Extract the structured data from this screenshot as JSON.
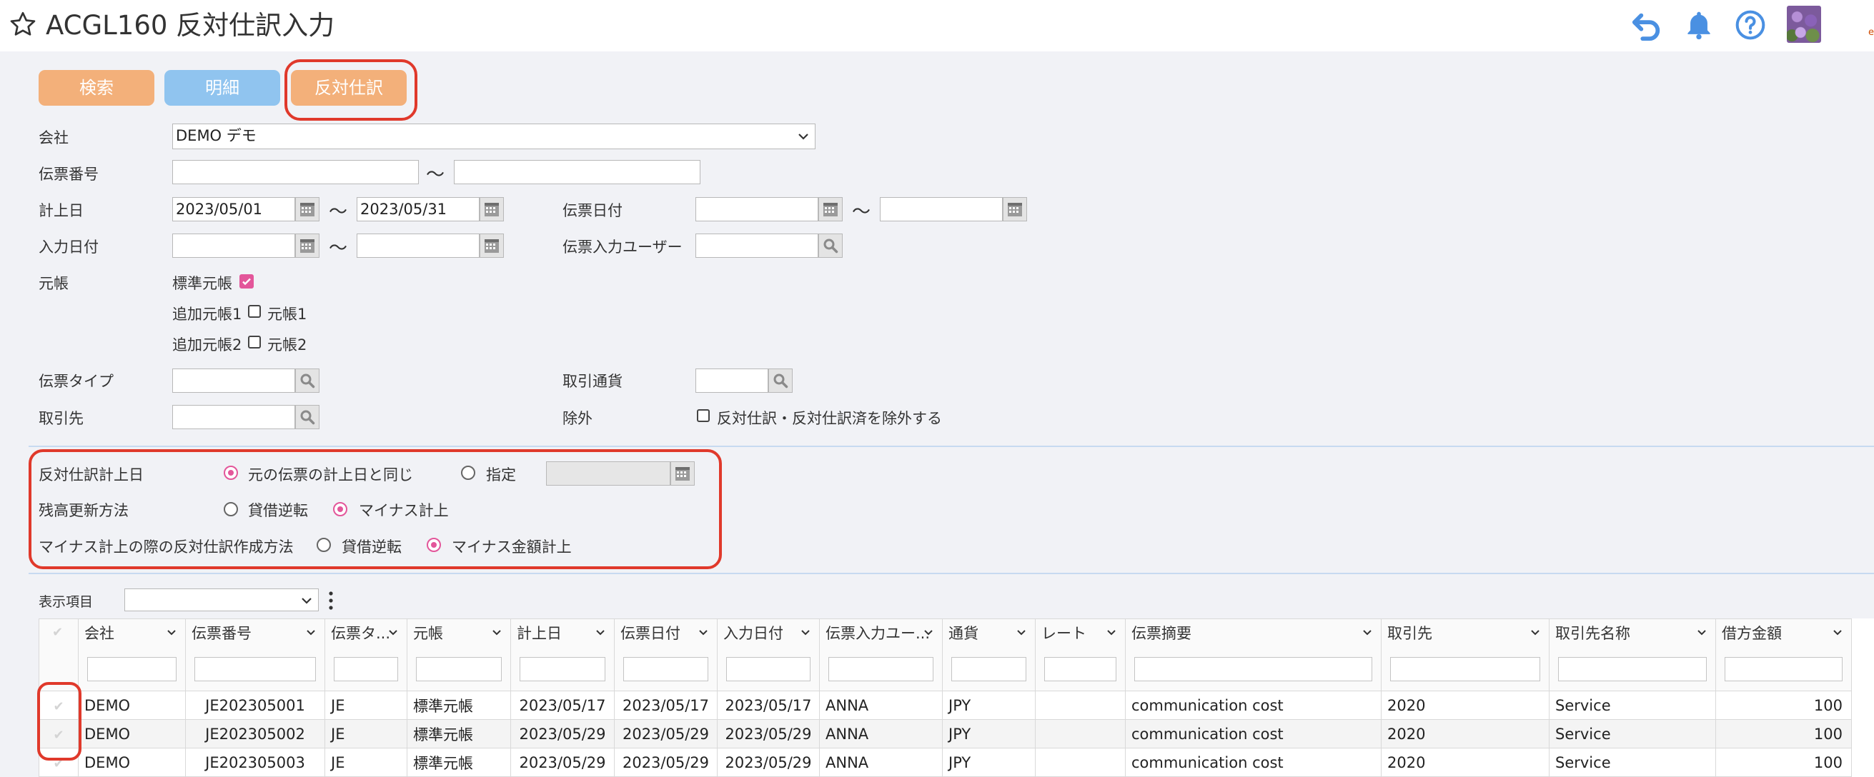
{
  "app": {
    "title": "ACGL160 反対仕訳入力",
    "edge_glyph": "e"
  },
  "toolbar": {
    "search_label": "検索",
    "detail_label": "明細",
    "reverse_label": "反対仕訳"
  },
  "form": {
    "company_label": "会社",
    "company_value": "DEMO デモ",
    "voucher_no_label": "伝票番号",
    "voucher_no_from": "",
    "voucher_no_to": "",
    "tilde": "〜",
    "posting_date_label": "計上日",
    "posting_date_from": "2023/05/01",
    "posting_date_to": "2023/05/31",
    "voucher_date_label": "伝票日付",
    "voucher_date_from": "",
    "voucher_date_to": "",
    "entry_date_label": "入力日付",
    "entry_date_from": "",
    "entry_date_to": "",
    "entry_user_label": "伝票入力ユーザー",
    "entry_user_value": "",
    "ledger_label": "元帳",
    "ledger_standard_label": "標準元帳",
    "ledger_standard_checked": true,
    "ledger_add1_label": "追加元帳1",
    "ledger_add1_option": "元帳1",
    "ledger_add1_checked": false,
    "ledger_add2_label": "追加元帳2",
    "ledger_add2_option": "元帳2",
    "ledger_add2_checked": false,
    "voucher_type_label": "伝票タイプ",
    "voucher_type_value": "",
    "currency_label": "取引通貨",
    "currency_value": "",
    "partner_label": "取引先",
    "partner_value": "",
    "exclude_label": "除外",
    "exclude_option": "反対仕訳・反対仕訳済を除外する",
    "exclude_checked": false
  },
  "reverse_settings": {
    "posting_date_label": "反対仕訳計上日",
    "posting_date_opt1": "元の伝票の計上日と同じ",
    "posting_date_opt2": "指定",
    "posting_date_selected": "opt1",
    "posting_date_value": "",
    "balance_label": "残高更新方法",
    "balance_opt1": "貸借逆転",
    "balance_opt2": "マイナス計上",
    "balance_selected": "opt2",
    "minus_label": "マイナス計上の際の反対仕訳作成方法",
    "minus_opt1": "貸借逆転",
    "minus_opt2": "マイナス金額計上",
    "minus_selected": "opt2"
  },
  "display": {
    "label": "表示項目",
    "value": ""
  },
  "grid": {
    "columns": [
      "会社",
      "伝票番号",
      "伝票タ...",
      "元帳",
      "計上日",
      "伝票日付",
      "入力日付",
      "伝票入力ユー...",
      "通貨",
      "レート",
      "伝票摘要",
      "取引先",
      "取引先名称",
      "借方金額"
    ],
    "rows": [
      [
        "DEMO",
        "JE202305001",
        "JE",
        "標準元帳",
        "2023/05/17",
        "2023/05/17",
        "2023/05/17",
        "ANNA",
        "JPY",
        "",
        "communication cost",
        "2020",
        "Service",
        "100"
      ],
      [
        "DEMO",
        "JE202305002",
        "JE",
        "標準元帳",
        "2023/05/29",
        "2023/05/29",
        "2023/05/29",
        "ANNA",
        "JPY",
        "",
        "communication cost",
        "2020",
        "Service",
        "100"
      ],
      [
        "DEMO",
        "JE202305003",
        "JE",
        "標準元帳",
        "2023/05/29",
        "2023/05/29",
        "2023/05/29",
        "ANNA",
        "JPY",
        "",
        "communication cost",
        "2020",
        "Service",
        "100"
      ]
    ]
  },
  "icons": {
    "star": "star-icon",
    "undo": "undo-icon",
    "bell": "bell-icon",
    "help": "help-icon",
    "calendar": "calendar-icon",
    "search": "search-icon",
    "chevron": "chevron-down-icon",
    "more": "more-vertical-icon",
    "check": "check-icon"
  },
  "colors": {
    "primary_orange": "#f3b07a",
    "primary_blue": "#90c4ef",
    "accent_pink": "#e3569a",
    "icon_blue": "#4a90e2",
    "highlight_red": "#e0392b"
  }
}
